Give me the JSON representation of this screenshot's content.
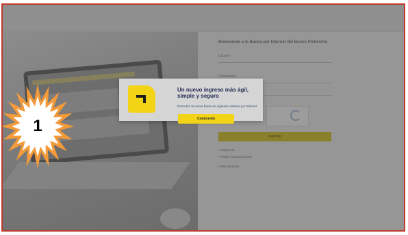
{
  "badge": {
    "number": "1",
    "color_outer": "#f39a3a",
    "color_inner": "#ffffff"
  },
  "form": {
    "title": "Bienvenido a la Banca por Internet del Banco Pichincha",
    "user_label": "Usuario",
    "password_label": "Contraseña",
    "submit_label": "Ingresar",
    "links": [
      "Regístrate",
      "Olvidé mi usuario/clave",
      "Más opciones"
    ]
  },
  "modal": {
    "title": "Un nuevo ingreso más ágil, simple y seguro",
    "subtitle": "Descubre la nueva forma de ingresar a Banca por Internet",
    "button_label": "Conócenlo",
    "accent": "#f2d316",
    "title_color": "#1f2a52"
  },
  "frame_color": "#c0392b"
}
